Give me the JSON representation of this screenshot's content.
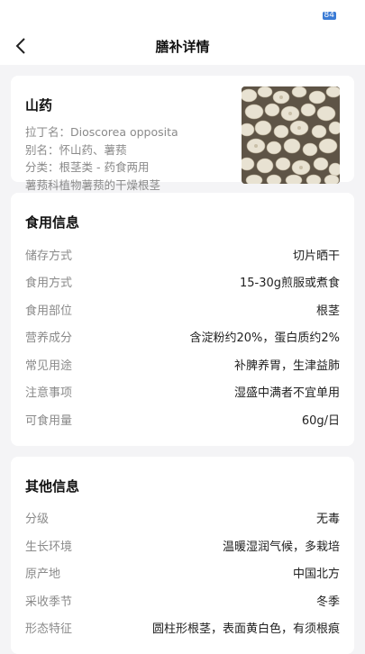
{
  "status": {
    "battery": "84"
  },
  "header": {
    "title": "膳补详情"
  },
  "summary": {
    "name": "山药",
    "latin": "拉丁名：Dioscorea opposita",
    "alias": "别名：怀山药、薯蓣",
    "category": "分类：根茎类 - 药食两用",
    "description": "薯蓣科植物薯蓣的干燥根茎",
    "image_icon": "dried-yam-slices-photo"
  },
  "food_info": {
    "title": "食用信息",
    "rows": [
      {
        "label": "储存方式",
        "value": "切片晒干"
      },
      {
        "label": "食用方式",
        "value": "15-30g煎服或煮食"
      },
      {
        "label": "食用部位",
        "value": "根茎"
      },
      {
        "label": "营养成分",
        "value": "含淀粉约20%，蛋白质约2%"
      },
      {
        "label": "常见用途",
        "value": "补脾养胃，生津益肺"
      },
      {
        "label": "注意事项",
        "value": "湿盛中满者不宜单用"
      },
      {
        "label": "可食用量",
        "value": "60g/日"
      }
    ]
  },
  "other_info": {
    "title": "其他信息",
    "rows": [
      {
        "label": "分级",
        "value": "无毒"
      },
      {
        "label": "生长环境",
        "value": "温暖湿润气候，多栽培"
      },
      {
        "label": "原产地",
        "value": "中国北方"
      },
      {
        "label": "采收季节",
        "value": "冬季"
      },
      {
        "label": "形态特征",
        "value": "圆柱形根茎，表面黄白色，有须根痕"
      }
    ]
  }
}
